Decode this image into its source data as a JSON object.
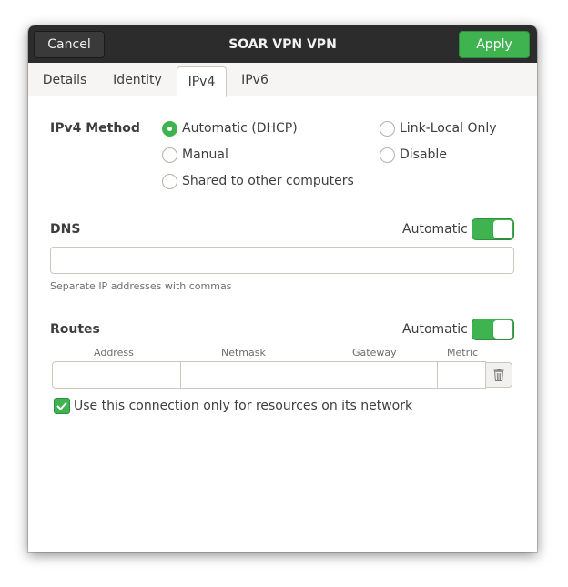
{
  "header": {
    "cancel_label": "Cancel",
    "title": "SOAR VPN VPN",
    "apply_label": "Apply"
  },
  "tabs": [
    {
      "label": "Details"
    },
    {
      "label": "Identity"
    },
    {
      "label": "IPv4",
      "active": true
    },
    {
      "label": "IPv6"
    }
  ],
  "ipv4_method": {
    "label": "IPv4 Method",
    "options": [
      {
        "label": "Automatic (DHCP)",
        "checked": true
      },
      {
        "label": "Manual",
        "checked": false
      },
      {
        "label": "Shared to other computers",
        "checked": false
      },
      {
        "label": "Link-Local Only",
        "checked": false
      },
      {
        "label": "Disable",
        "checked": false
      }
    ]
  },
  "dns": {
    "label": "DNS",
    "automatic_label": "Automatic",
    "automatic_on": true,
    "value": "",
    "hint": "Separate IP addresses with commas"
  },
  "routes": {
    "label": "Routes",
    "automatic_label": "Automatic",
    "automatic_on": true,
    "columns": [
      "Address",
      "Netmask",
      "Gateway",
      "Metric"
    ],
    "row": {
      "address": "",
      "netmask": "",
      "gateway": "",
      "metric": ""
    }
  },
  "only_local": {
    "label": "Use this connection only for resources on its network",
    "checked": true
  },
  "icons": {
    "trash": "trash-icon",
    "check": "check-icon"
  },
  "colors": {
    "accent": "#3eb34f",
    "headerbar": "#2c2c2c"
  }
}
